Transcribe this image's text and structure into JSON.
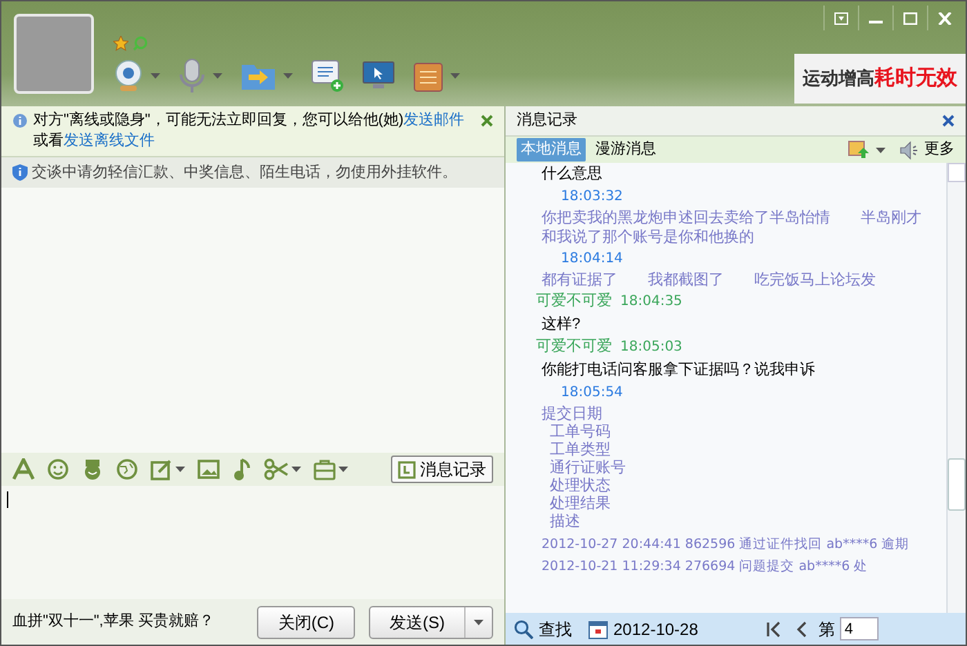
{
  "ad_banner": {
    "text": "运动增高",
    "highlight": "耗时无效"
  },
  "toolbar": [
    {
      "dropdown": true
    },
    {
      "dropdown": true
    },
    {
      "dropdown": true
    },
    {
      "dropdown": false
    },
    {
      "dropdown": false
    },
    {
      "dropdown": true
    }
  ],
  "notice": {
    "text": "对方\"离线或隐身\"，可能无法立即回复，您可以给他(她)",
    "link_1": "发送邮件",
    "middle": "或看",
    "link_2": "发送离线文件"
  },
  "security_notice": "交谈中请勿轻信汇款、中奖信息、陌生电话，勿使用外挂软件。",
  "input_toolbar": {
    "icons": [
      {
        "dropdown": false
      },
      {
        "dropdown": false
      },
      {
        "dropdown": false
      },
      {
        "dropdown": false
      },
      {
        "dropdown": true
      },
      {
        "dropdown": false
      },
      {
        "dropdown": false
      },
      {
        "dropdown": true
      },
      {
        "dropdown": true
      }
    ],
    "history_button": "消息记录"
  },
  "ad_text": "血拼\"双十一\",苹果 买贵就赔？",
  "buttons": [
    {
      "label": "关闭(C)",
      "dropdown": false
    },
    {
      "label": "发送(S)",
      "dropdown": true
    }
  ],
  "history": {
    "title": "消息记录",
    "tabs": [
      {
        "label": "本地消息",
        "selected": true
      },
      {
        "label": "漫游消息",
        "selected": false
      }
    ],
    "more": "更多",
    "messages": [
      {
        "kind": "text",
        "text": "什么意思"
      },
      {
        "kind": "time",
        "text": "18:03:32"
      },
      {
        "kind": "other",
        "text": "你把卖我的黑龙炮申述回去卖给了半岛怡情　　半岛刚才和我说了那个账号是你和他换的"
      },
      {
        "kind": "time",
        "text": "18:04:14"
      },
      {
        "kind": "other",
        "text": "都有证据了　　我都截图了　　吃完饭马上论坛发"
      },
      {
        "kind": "header",
        "name": "可爱不可爱",
        "text": "18:04:35"
      },
      {
        "kind": "text",
        "text": "这样?"
      },
      {
        "kind": "header",
        "name": "可爱不可爱",
        "text": "18:05:03"
      },
      {
        "kind": "text",
        "text": "你能打电话问客服拿下证据吗？说我申诉"
      },
      {
        "kind": "time",
        "text": "18:05:54"
      },
      {
        "kind": "other",
        "text": "提交日期"
      },
      {
        "kind": "field",
        "text": "工单号码"
      },
      {
        "kind": "field",
        "text": "工单类型"
      },
      {
        "kind": "field",
        "text": "通行证账号"
      },
      {
        "kind": "field",
        "text": "处理状态"
      },
      {
        "kind": "field",
        "text": "处理结果"
      },
      {
        "kind": "field",
        "text": "描述"
      },
      {
        "kind": "record",
        "text": "2012-10-27 20:44:41 862596 通过证件找回 ab****6 逾期"
      },
      {
        "kind": "record",
        "text": "2012-10-21 11:29:34 276694 问题提交 ab****6 处"
      }
    ],
    "search": "查找",
    "date": "2012-10-28",
    "page_label": "第",
    "page": "4"
  }
}
